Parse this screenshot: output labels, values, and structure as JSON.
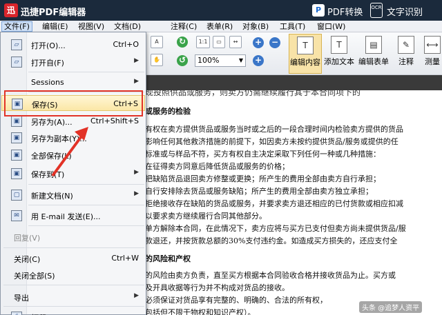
{
  "app": {
    "title": "迅捷PDF编辑器",
    "logo_glyph": "迅",
    "pdf_convert_icon": "pdf-convert-icon",
    "pdf_convert_glyph": "P",
    "pdf_convert": "PDF转换",
    "ocr_icon": "ocr-icon",
    "ocr_glyph": "OCR",
    "ocr": "文字识别"
  },
  "menubar": [
    "文件(F)",
    "编辑(E)",
    "视图(V)",
    "文档(D)",
    "注释(C)",
    "表单(R)",
    "对象(B)",
    "工具(T)",
    "窗口(W)"
  ],
  "toolbar": {
    "zoom": "100%",
    "fit_page_glyph": "1:1",
    "zoom_in_glyph": "+",
    "zoom_out_glyph": "−",
    "edit_content": "编辑内容",
    "add_text": "添加文本",
    "edit_form": "编辑表单",
    "annotate": "注释",
    "measure": "测量",
    "edit_content_glyph": "T",
    "add_text_glyph": "T",
    "edit_form_glyph": "▤",
    "annotate_glyph": "✎",
    "measure_glyph": "⟷"
  },
  "file_menu": {
    "open": {
      "label": "打开(O)...",
      "shortcut": "Ctrl+O"
    },
    "open_from": {
      "label": "打开自(F)"
    },
    "sessions": {
      "label": "Sessions"
    },
    "save": {
      "label": "保存(S)",
      "shortcut": "Ctrl+S"
    },
    "save_as": {
      "label": "另存为(A)...",
      "shortcut": "Ctrl+Shift+S"
    },
    "save_copy": {
      "label": "另存为副本(Y)..."
    },
    "save_all": {
      "label": "全部保存(L)"
    },
    "save_to": {
      "label": "保存到(T)"
    },
    "new_document": {
      "label": "新建文档(N)"
    },
    "send_email": {
      "label": "用 E-mail 发送(E)..."
    },
    "revert": {
      "label": "回复(V)"
    },
    "close": {
      "label": "关闭(C)",
      "shortcut": "Ctrl+W"
    },
    "close_all": {
      "label": "关闭全部(S)"
    },
    "export": {
      "label": "导出"
    },
    "print": {
      "label": "打印"
    },
    "submenu_arrow": "▶"
  },
  "document": {
    "cut_line": "现投照供品或服务，则卖方仍需继续履行其于本合同项下的",
    "lines": [
      "或服务的检验",
      "有权在卖方提供货品或服务当时或之后的一段合理时间内检验卖方提供的货品",
      "影响任何其他救济措施的前提下，如因卖方未按约提供货品/服务或提供的任",
      "标准或与样品不符，买方有权自主决定采取下列任何一种或几种措施：",
      "在征得卖方同意后降低货品或服务的价格；",
      "把缺陷货品退回卖方修整或更换；所产生的费用全部由卖方自行承担；",
      "自行安排除去货品或服务缺陷；所产生的费用全部由卖方独立承担；",
      "拒绝接收存在缺陷的货品或服务，并要求卖方退还相应的已付货款或相应扣减",
      "以要求卖方继续履行合同其他部分。",
      "单方解除本合同，在此情况下，卖方应将与买方已支付但卖方尚未提供货品/服",
      "款退还，并按货款总额的30%支付违约金。如造成买方损失的，还应支付全",
      "的风险和产权",
      "的风险由卖方负责，直至买方根据本合同验收合格并接收货品为止。买方或",
      "及开具收据等行为并不构成对货品的接收。",
      "必须保证对货品享有完整的、明确的、合法的所有权，",
      "包括但不限于物权和知识产权）。"
    ],
    "watermark": "头条 @追梦人资平"
  },
  "annotation_color": "#e23227"
}
